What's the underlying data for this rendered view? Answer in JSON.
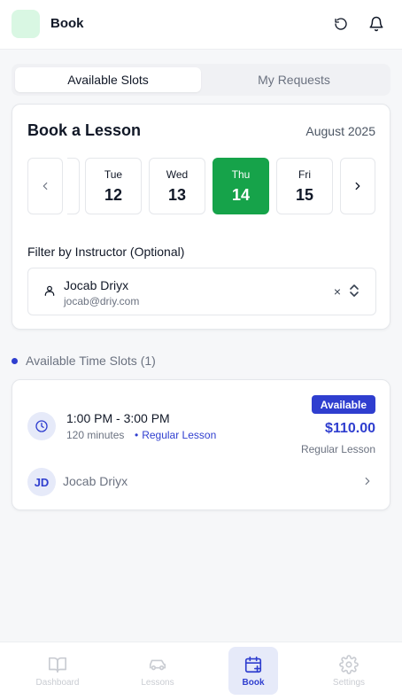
{
  "header": {
    "title": "Book"
  },
  "tabs": [
    {
      "label": "Available Slots",
      "active": true
    },
    {
      "label": "My Requests",
      "active": false
    }
  ],
  "booking": {
    "title": "Book a Lesson",
    "month": "August 2025",
    "dates": [
      {
        "dow": "Tue",
        "day": "12",
        "selected": false
      },
      {
        "dow": "Wed",
        "day": "13",
        "selected": false
      },
      {
        "dow": "Thu",
        "day": "14",
        "selected": true
      },
      {
        "dow": "Fri",
        "day": "15",
        "selected": false
      }
    ],
    "filter_label": "Filter by Instructor (Optional)",
    "instructor": {
      "name": "Jocab Driyx",
      "email": "jocab@driy.com"
    },
    "clear_symbol": "×"
  },
  "slots_section": {
    "title": "Available Time Slots (1)"
  },
  "slot": {
    "time": "1:00 PM - 3:00 PM",
    "duration": "120 minutes",
    "type": "Regular Lesson",
    "badge": "Available",
    "price": "$110.00",
    "price_type": "Regular Lesson",
    "instructor_initials": "JD",
    "instructor_name": "Jocab Driyx"
  },
  "nav": {
    "items": [
      {
        "label": "Dashboard",
        "icon": "book-open-icon"
      },
      {
        "label": "Lessons",
        "icon": "car-icon"
      },
      {
        "label": "Book",
        "icon": "calendar-plus-icon",
        "active": true
      },
      {
        "label": "Settings",
        "icon": "gear-icon"
      }
    ]
  },
  "colors": {
    "accent": "#2f3ecf",
    "selected_date": "#16a34a",
    "logo_bg": "#d9f7e3"
  }
}
